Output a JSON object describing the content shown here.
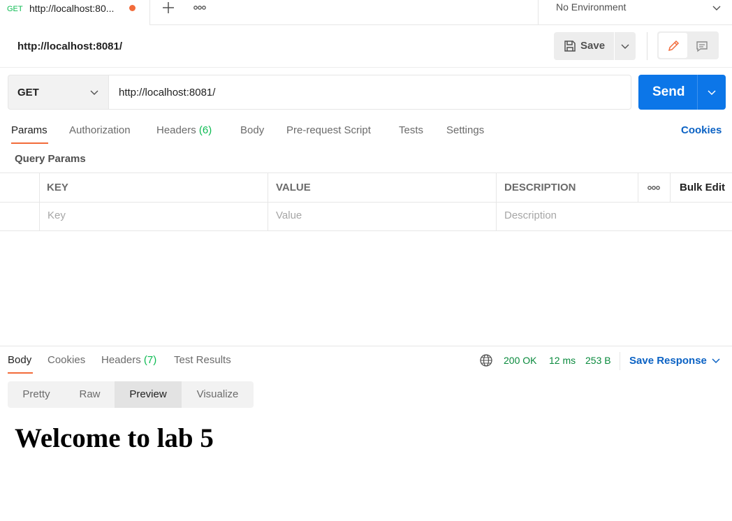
{
  "tab": {
    "method": "GET",
    "title": "http://localhost:80...",
    "unsaved_color": "#f26b3a"
  },
  "environment": {
    "label": "No Environment"
  },
  "request": {
    "title": "http://localhost:8081/",
    "save_label": "Save",
    "method": "GET",
    "url": "http://localhost:8081/",
    "send_label": "Send"
  },
  "request_tabs": [
    {
      "label": "Params"
    },
    {
      "label": "Authorization"
    },
    {
      "label": "Headers",
      "count": "(6)"
    },
    {
      "label": "Body"
    },
    {
      "label": "Pre-request Script"
    },
    {
      "label": "Tests"
    },
    {
      "label": "Settings"
    }
  ],
  "cookies_label": "Cookies",
  "query_params": {
    "title": "Query Params",
    "columns": [
      "KEY",
      "VALUE",
      "DESCRIPTION"
    ],
    "bulk_edit_label": "Bulk Edit",
    "placeholders": {
      "key": "Key",
      "value": "Value",
      "description": "Description"
    }
  },
  "response": {
    "tabs": [
      {
        "label": "Body"
      },
      {
        "label": "Cookies"
      },
      {
        "label": "Headers",
        "count": "(7)"
      },
      {
        "label": "Test Results"
      }
    ],
    "status": "200 OK",
    "time": "12 ms",
    "size": "253 B",
    "save_response_label": "Save Response",
    "view_modes": [
      "Pretty",
      "Raw",
      "Preview",
      "Visualize"
    ],
    "active_view": "Preview",
    "preview_heading": "Welcome to lab 5"
  },
  "colors": {
    "accent": "#f26b3a",
    "send_blue": "#0c76e8",
    "link_blue": "#0b62c4",
    "status_green": "#0a8a3d",
    "count_green": "#0cbb52"
  },
  "icons": [
    "plus-icon",
    "more-horizontal-icon",
    "chevron-down-icon",
    "save-icon",
    "pencil-icon",
    "comment-icon",
    "globe-icon"
  ]
}
